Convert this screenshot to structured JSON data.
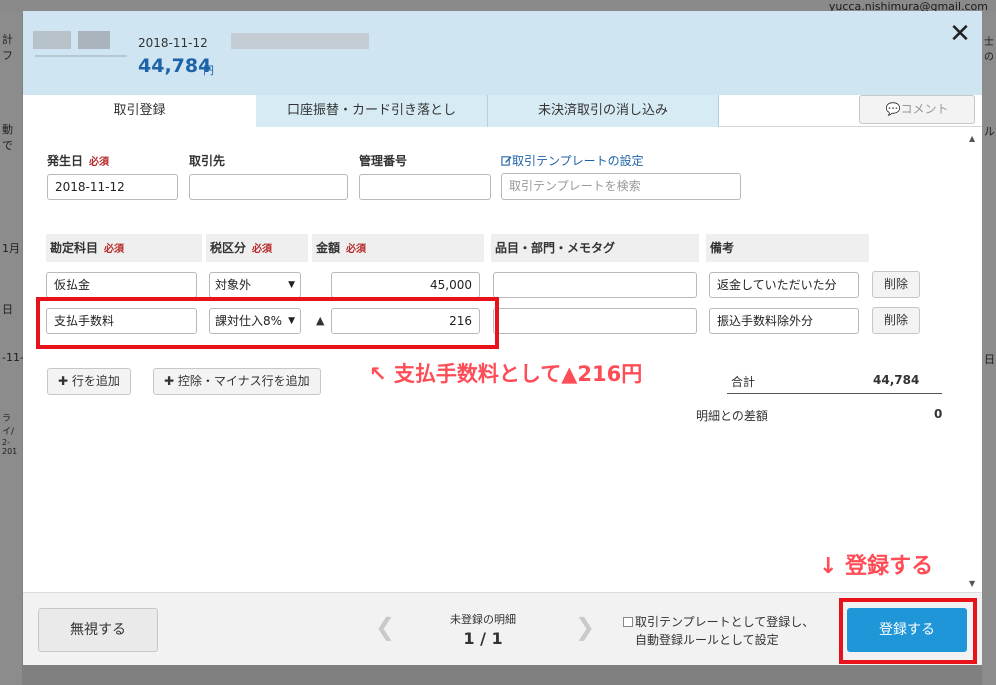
{
  "background": {
    "email": "yucca.nishimura@gmail.com",
    "left_fragments": [
      "計フ",
      "動で",
      "1月",
      "日",
      "-11-",
      "ライ/",
      "2-201"
    ],
    "right_fragments": [
      "士の",
      "ル",
      "日"
    ]
  },
  "header": {
    "date": "2018-11-12",
    "amount": "44,784",
    "unit": "円",
    "close_label": "✕"
  },
  "tabs": [
    {
      "label": "取引登録"
    },
    {
      "label": "口座振替・カード引き落とし"
    },
    {
      "label": "未決済取引の消し込み"
    }
  ],
  "comment_button": "💬コメント",
  "form": {
    "issue_date_label": "発生日",
    "required": "必須",
    "issue_date_value": "2018-11-12",
    "partner_label": "取引先",
    "partner_value": "",
    "mgmt_number_label": "管理番号",
    "mgmt_number_value": "",
    "template_link": "取引テンプレートの設定",
    "template_search_placeholder": "取引テンプレートを検索"
  },
  "table": {
    "headers": {
      "account": "勘定科目",
      "tax": "税区分",
      "amount": "金額",
      "items": "品目・部門・メモタグ",
      "remarks": "備考"
    },
    "rows": [
      {
        "account": "仮払金",
        "tax": "対象外",
        "sign": "",
        "amount": "45,000",
        "items": "",
        "remarks": "返金していただいた分",
        "delete": "削除"
      },
      {
        "account": "支払手数料",
        "tax": "課対仕入8%",
        "sign": "▲",
        "amount": "216",
        "items": "",
        "remarks": "振込手数料除外分",
        "delete": "削除"
      }
    ]
  },
  "actions": {
    "add_row": "行を追加",
    "add_deduction_row": "控除・マイナス行を追加"
  },
  "summary": {
    "total_label": "合計",
    "total_value": "44,784",
    "diff_label": "明細との差額",
    "diff_value": "0"
  },
  "annotations": {
    "fee_note": "↖ 支払手数料として▲216円",
    "register_note": "↓ 登録する"
  },
  "footer": {
    "ignore_label": "無視する",
    "unregistered_label": "未登録の明細",
    "page": "1 / 1",
    "template_checkbox_line1": "取引テンプレートとして登録し、",
    "template_checkbox_line2": "自動登録ルールとして設定",
    "register_label": "登録する"
  },
  "colors": {
    "header_bg": "#cfe6f2",
    "accent_blue": "#1e63a8",
    "register_blue": "#1f96d8",
    "required_red": "#b72a2a",
    "annotation_red": "#e8131a"
  }
}
